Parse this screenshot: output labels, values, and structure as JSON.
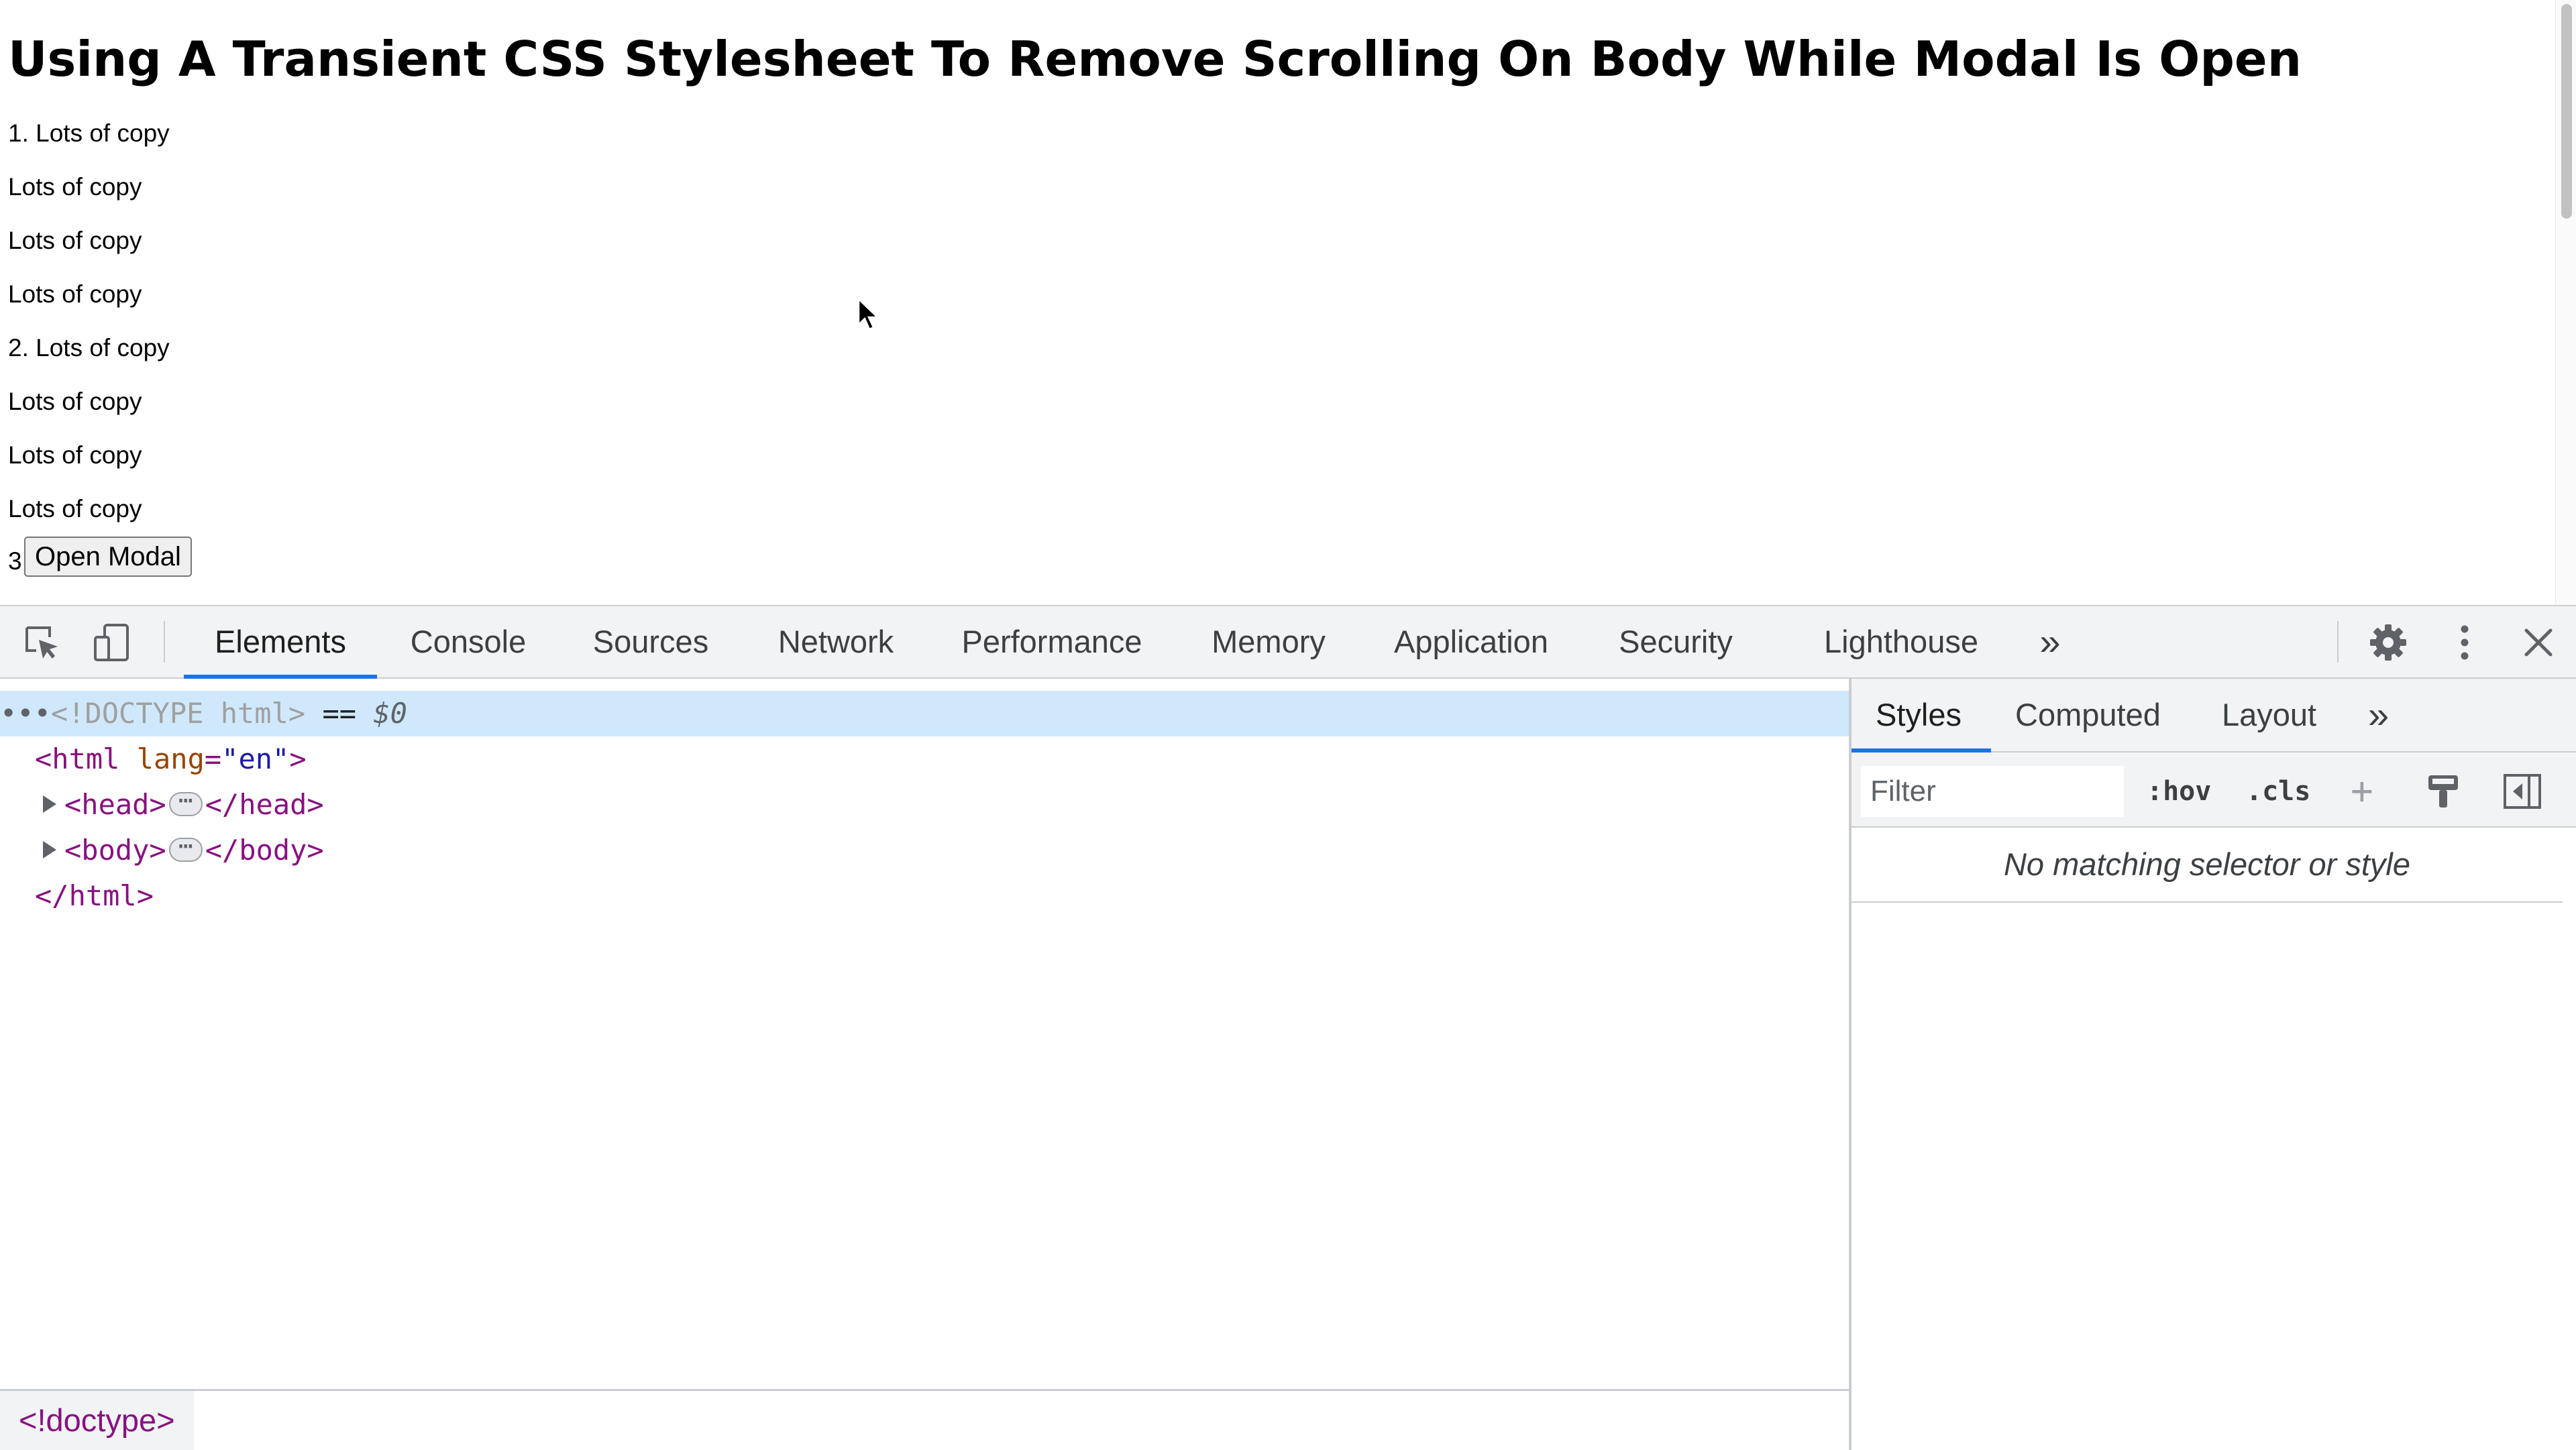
{
  "page": {
    "title": "Using A Transient CSS Stylesheet To Remove Scrolling On Body While Modal Is Open",
    "copy_lines": [
      "1. Lots of copy",
      "Lots of copy",
      "Lots of copy",
      "Lots of copy",
      "2. Lots of copy",
      "Lots of copy",
      "Lots of copy",
      "Lots of copy"
    ],
    "row_prefix": "3",
    "open_modal_label": "Open Modal"
  },
  "devtools": {
    "toolbar_icons": [
      "inspect-element-icon",
      "device-toolbar-icon"
    ],
    "tabs": [
      "Elements",
      "Console",
      "Sources",
      "Network",
      "Performance",
      "Memory",
      "Application",
      "Security",
      "Lighthouse"
    ],
    "active_tab": "Elements",
    "overflow_glyph": "»",
    "right_icons": [
      "gear-icon",
      "kebab-menu-icon",
      "close-icon"
    ],
    "dom": {
      "doctype_prefix": "•••",
      "doctype": "<!DOCTYPE html>",
      "selected_eq": "==",
      "selected_var": "$0",
      "html_open_tag": "<html",
      "html_attr_name": "lang",
      "html_attr_eq": "=",
      "html_attr_value": "\"en\"",
      "html_open_close": ">",
      "head_open": "<head>",
      "head_close": "</head>",
      "body_open": "<body>",
      "body_close": "</body>",
      "html_close": "</html>",
      "ellipsis": "⋯"
    },
    "breadcrumb": "<!doctype>",
    "styles": {
      "tabs": [
        "Styles",
        "Computed",
        "Layout"
      ],
      "active_tab": "Styles",
      "overflow_glyph": "»",
      "filter_placeholder": "Filter",
      "hov_label": ":hov",
      "cls_label": ".cls",
      "add_label": "+",
      "empty_message": "No matching selector or style"
    },
    "colors": {
      "accent": "#1a73e8",
      "selected_row": "#cfe8fc",
      "tag": "#881280",
      "attr_name": "#994500",
      "attr_value": "#1a1aa6"
    }
  }
}
